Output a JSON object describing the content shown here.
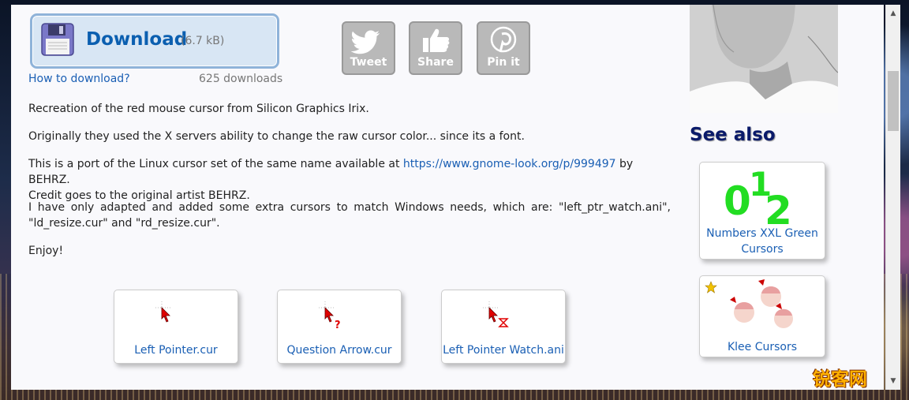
{
  "download": {
    "label": "Download",
    "size": "(6.7 kB)",
    "how_to": "How to download?",
    "count": "625 downloads"
  },
  "social": [
    {
      "label": "Tweet",
      "icon": "twitter-bird-icon"
    },
    {
      "label": "Share",
      "icon": "thumbs-up-icon"
    },
    {
      "label": "Pin it",
      "icon": "pinterest-icon"
    }
  ],
  "description": {
    "p1": "Recreation of the red mouse cursor from Silicon Graphics Irix.",
    "p2": "Originally they used the X servers ability to change the raw cursor color... since its a font.",
    "p3_before": "This is a port of the Linux cursor set of the same name available at ",
    "p3_link": "https://www.gnome-look.org/p/999497",
    "p3_after": " by BEHRZ.",
    "p3_line2": "Credit goes to the original artist BEHRZ.",
    "p4_line1": "I have only adapted and added some extra cursors to match Windows needs, which are: \"left_ptr_watch.ani\",",
    "p4_line2": "\"ld_resize.cur\" and \"rd_resize.cur\".",
    "p5": "Enjoy!"
  },
  "cursor_files": [
    {
      "name": "Left Pointer.cur",
      "icon": "red-arrow-cursor-icon"
    },
    {
      "name": "Question Arrow.cur",
      "icon": "red-question-arrow-cursor-icon"
    },
    {
      "name": "Left Pointer Watch.ani",
      "icon": "red-arrow-hourglass-cursor-icon"
    }
  ],
  "sidebar": {
    "see_also": "See also",
    "items": [
      {
        "title_line1": "Numbers XXL Green",
        "title_line2": "Cursors",
        "thumb_text": "012"
      },
      {
        "title_line1": "Klee Cursors",
        "title_line2": ""
      }
    ]
  },
  "watermark": "锐客网",
  "colors": {
    "link": "#1a5fb4",
    "download_accent": "#0b5fb0",
    "see_also": "#0a1a6a",
    "green_digits": "#22dd22",
    "cursor_red": "#e00000"
  }
}
